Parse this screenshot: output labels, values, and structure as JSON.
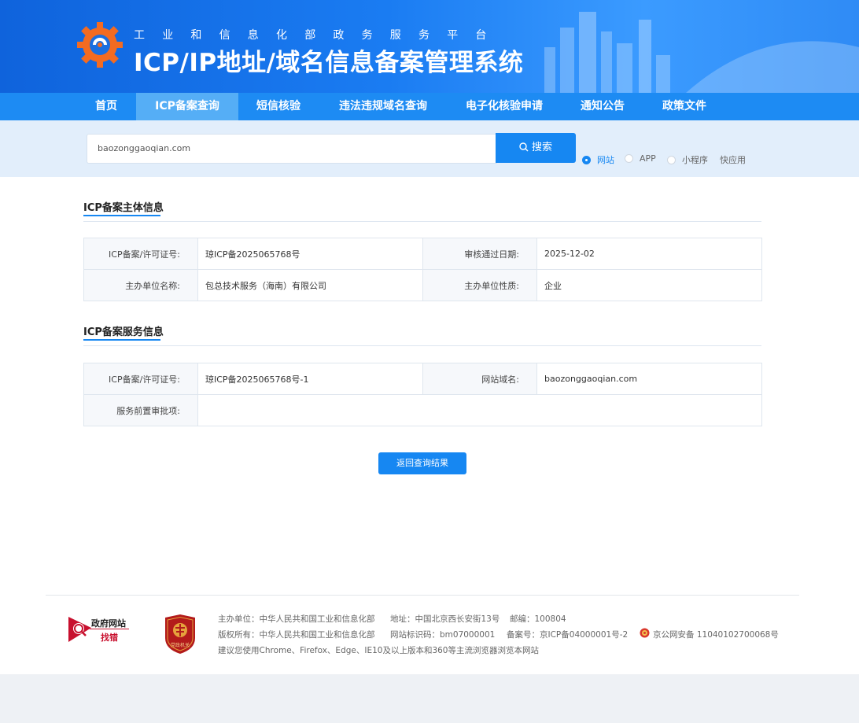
{
  "header": {
    "subtitle": "工业和信息化部政务服务平台",
    "title": "ICP/IP地址/域名信息备案管理系统"
  },
  "nav": {
    "items": [
      "首页",
      "ICP备案查询",
      "短信核验",
      "违法违规域名查询",
      "电子化核验申请",
      "通知公告",
      "政策文件"
    ],
    "active": "ICP备案查询"
  },
  "search": {
    "value": "baozonggaoqian.com",
    "button_label": "搜索",
    "types": [
      "网站",
      "APP",
      "小程序",
      "快应用"
    ],
    "selected_type": "网站"
  },
  "section_subject": {
    "title": "ICP备案主体信息",
    "rows": [
      {
        "label1": "ICP备案/许可证号:",
        "value1": "琼ICP备2025065768号",
        "label2": "审核通过日期:",
        "value2": "2025-12-02"
      },
      {
        "label1": "主办单位名称:",
        "value1": "包总技术服务（海南）有限公司",
        "label2": "主办单位性质:",
        "value2": "企业"
      }
    ]
  },
  "section_service": {
    "title": "ICP备案服务信息",
    "rows": [
      {
        "label1": "ICP备案/许可证号:",
        "value1": "琼ICP备2025065768号-1",
        "label2": "网站域名:",
        "value2": "baozonggaoqian.com"
      },
      {
        "label1": "服务前置审批项:",
        "value1": ""
      }
    ]
  },
  "back_button_label": "返回查询结果",
  "footer": {
    "gov_site_label": "政府网站",
    "gov_error_label": "找错",
    "badge_label": "党政机关",
    "organizer": "主办单位：中华人民共和国工业和信息化部",
    "address": "地址：中国北京西长安街13号",
    "postcode": "邮编：100804",
    "copyright": "版权所有：中华人民共和国工业和信息化部",
    "site_id": "网站标识码：bm07000001",
    "icp_no": "备案号：京ICP备04000001号-2",
    "police_no": "京公网安备 11040102700068号",
    "browser_note": "建议您使用Chrome、Firefox、Edge、IE10及以上版本和360等主流浏览器浏览本网站"
  },
  "colors": {
    "primary": "#1687f2",
    "nav": "#1d8bf3",
    "nav_active": "#55aef6",
    "header": "#0f63dc"
  },
  "icons": {
    "logo": "gear-logo-icon",
    "search": "search-icon",
    "police": "police-badge-icon"
  }
}
